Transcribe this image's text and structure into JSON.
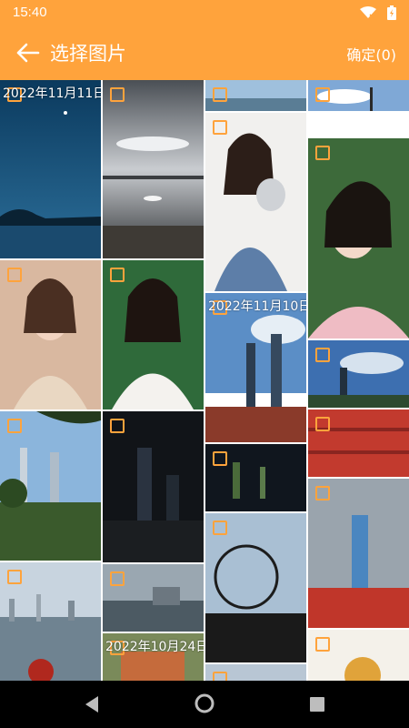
{
  "status": {
    "time": "15:40"
  },
  "toolbar": {
    "title": "选择图片",
    "confirm": "确定(0)"
  },
  "grid": {
    "dates": [
      "2022年11月11日",
      "2022年11月10日",
      "2022年10月24日"
    ]
  },
  "colors": {
    "accent": "#FFA33C"
  }
}
